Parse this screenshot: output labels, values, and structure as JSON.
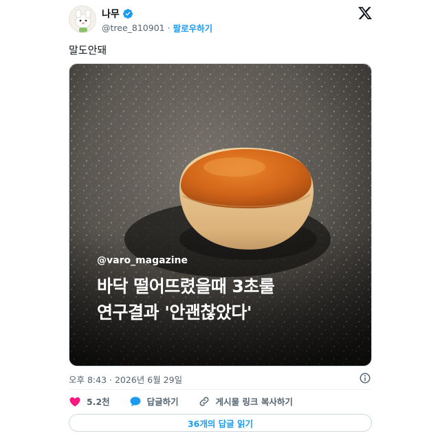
{
  "author": {
    "display_name": "나무",
    "handle": "@tree_810901",
    "separator": "·",
    "follow_label": "팔로우하기"
  },
  "tweet": {
    "text": "말도안돼",
    "timestamp": "오후 8:43 · 2026년 6월 29일"
  },
  "media": {
    "overlay_handle": "@varo_magazine",
    "overlay_title_line1": "바닥 떨어뜨렸을때 3초룰",
    "overlay_title_line2": "연구결과 '안괜찮았다'"
  },
  "actions": {
    "like_count": "5.2천",
    "reply_label": "답글하기",
    "copy_link_label": "게시물 링크 복사하기",
    "read_replies_label": "36개의 답글 읽기"
  },
  "icons": {
    "verified": "verified-badge-icon",
    "x_logo": "x-logo-icon",
    "info": "info-icon",
    "heart": "heart-icon",
    "reply": "speech-bubble-icon",
    "link": "link-icon"
  },
  "colors": {
    "accent": "#1d9bf0",
    "like": "#f91880",
    "muted": "#536471",
    "text": "#0f1419"
  }
}
